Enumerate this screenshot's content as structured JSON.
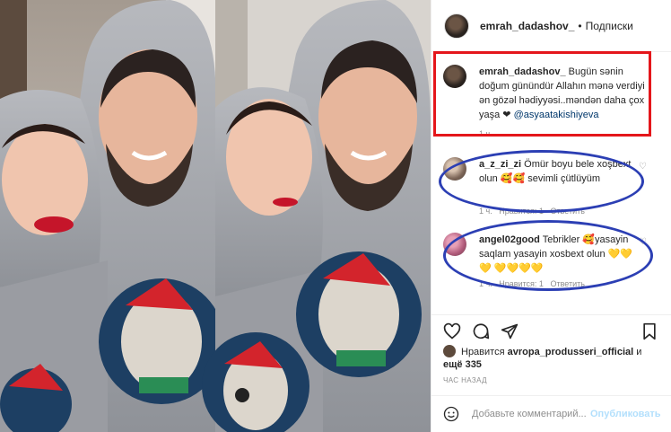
{
  "post": {
    "username": "emrah_dadashov_",
    "separator": "•",
    "follow_label": "Подписки"
  },
  "caption": {
    "username": "emrah_dadashov_",
    "text": " Bugün sənin doğum günündür Allahın mənə verdiyi ən gözəl hədiyyəsi..məndən daha çox yaşa ❤ ",
    "mention": "@asyaatakishiyeva",
    "time": "1 ч."
  },
  "comments": [
    {
      "username": "a_z_zi_zi",
      "text": " Ömür boyu bele xoşbext olun 🥰🥰 sevimli çütlüyüm",
      "time": "1 ч.",
      "likes_label": "Нравится: 1",
      "reply_label": "Ответить"
    },
    {
      "username": "angel02good",
      "text": " Tebrikler 🥰yasayin saqlam yasayin xosbext olun 💛💛💛 💛💛💛💛",
      "time": "1 ч.",
      "likes_label": "Нравится: 1",
      "reply_label": "Ответить"
    }
  ],
  "likes": {
    "prefix": "Нравится ",
    "user": "avropa_produsseri_official",
    "suffix": " и",
    "more": "ещё 335"
  },
  "timestamp": "ЧАС НАЗАД",
  "add_comment": {
    "placeholder": "Добавьте комментарий...",
    "publish_label": "Опубликовать"
  },
  "icons": {
    "like": "heart-icon",
    "comment": "comment-icon",
    "share": "share-icon",
    "save": "bookmark-icon",
    "emoji": "emoji-icon"
  },
  "annotation_colors": {
    "caption_box": "#e4161b",
    "comment_ellipses": "#2c3fb4"
  }
}
